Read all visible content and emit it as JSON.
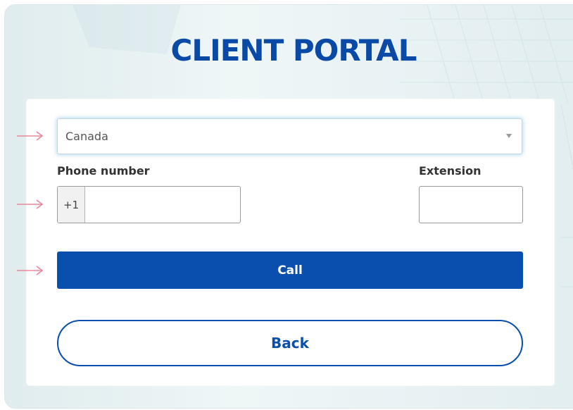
{
  "portal": {
    "title": "CLIENT PORTAL"
  },
  "form": {
    "country_select": {
      "value": "Canada"
    },
    "phone": {
      "label": "Phone number",
      "prefix": "+1",
      "value": ""
    },
    "extension": {
      "label": "Extension",
      "value": ""
    },
    "call_label": "Call",
    "back_label": "Back"
  },
  "colors": {
    "brand_blue": "#0a4fad",
    "title_blue": "#0a4aa6",
    "annotation_arrow": "#e8889a"
  },
  "annotations": {
    "arrow_icon": "arrow-right-icon",
    "count": 3
  }
}
